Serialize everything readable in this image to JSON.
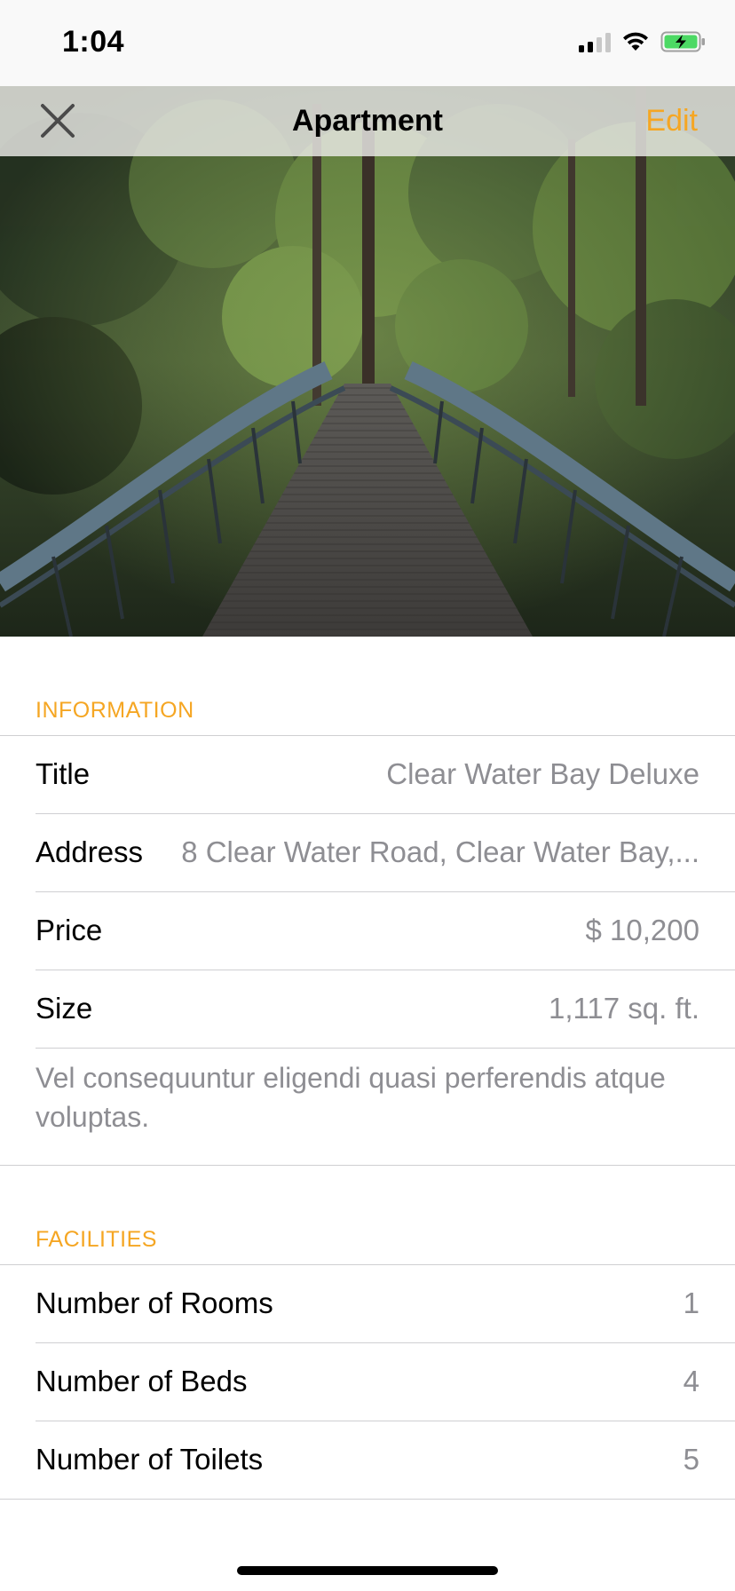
{
  "status_bar": {
    "time": "1:04"
  },
  "nav": {
    "title": "Apartment",
    "edit_label": "Edit"
  },
  "colors": {
    "accent": "#f5a623",
    "secondary_text": "#8e8e93",
    "separator": "#cfcfd2"
  },
  "information": {
    "header": "INFORMATION",
    "rows": [
      {
        "label": "Title",
        "value": "Clear Water Bay Deluxe"
      },
      {
        "label": "Address",
        "value": "8 Clear Water Road, Clear Water Bay,..."
      },
      {
        "label": "Price",
        "value": "$ 10,200"
      },
      {
        "label": "Size",
        "value": "1,117 sq. ft."
      }
    ],
    "description": "Vel consequuntur eligendi quasi perferendis atque voluptas."
  },
  "facilities": {
    "header": "FACILITIES",
    "rows": [
      {
        "label": "Number of Rooms",
        "value": "1"
      },
      {
        "label": "Number of Beds",
        "value": "4"
      },
      {
        "label": "Number of Toilets",
        "value": "5"
      }
    ]
  }
}
